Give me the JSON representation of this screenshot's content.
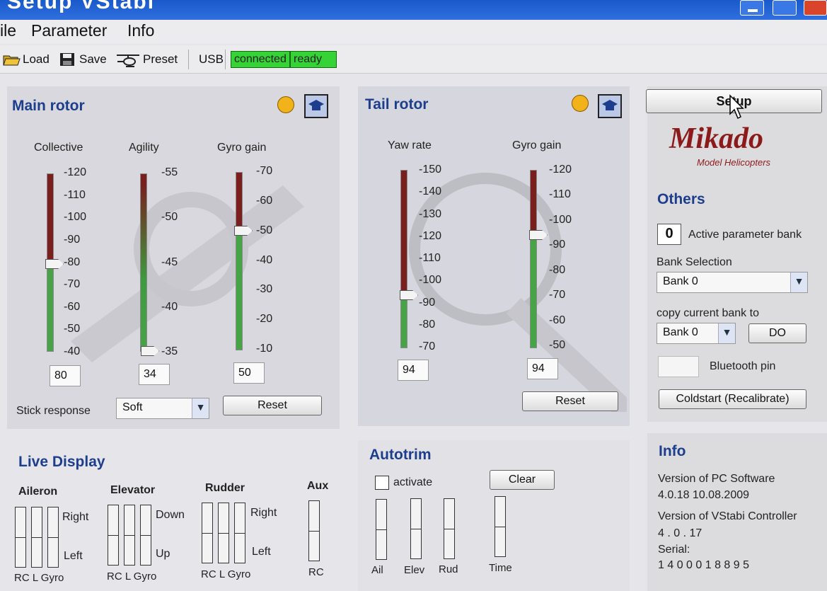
{
  "window": {
    "title": "Setup VStabi"
  },
  "menu": [
    "ile",
    "Parameter",
    "Info"
  ],
  "toolbar": {
    "load": "Load",
    "save": "Save",
    "preset": "Preset",
    "usb": "USB",
    "connected": "connected",
    "ready": "ready"
  },
  "main_rotor": {
    "title": "Main rotor",
    "collective": {
      "label": "Collective",
      "ticks": [
        "120",
        "110",
        "100",
        "90",
        "80",
        "70",
        "60",
        "50",
        "40"
      ],
      "value": "80"
    },
    "agility": {
      "label": "Agility",
      "ticks": [
        "55",
        "50",
        "45",
        "40",
        "35"
      ],
      "value": "34"
    },
    "gyro_gain": {
      "label": "Gyro gain",
      "ticks": [
        "70",
        "60",
        "50",
        "40",
        "30",
        "20",
        "10"
      ],
      "value": "50"
    },
    "stick_response_label": "Stick response",
    "stick_response_value": "Soft",
    "reset": "Reset"
  },
  "tail_rotor": {
    "title": "Tail rotor",
    "yaw_rate": {
      "label": "Yaw rate",
      "ticks": [
        "150",
        "140",
        "130",
        "120",
        "110",
        "100",
        "90",
        "80",
        "70"
      ],
      "value": "94"
    },
    "gyro_gain": {
      "label": "Gyro gain",
      "ticks": [
        "120",
        "110",
        "100",
        "90",
        "80",
        "70",
        "60",
        "50"
      ],
      "value": "94"
    },
    "reset": "Reset"
  },
  "side": {
    "setup": "Setup",
    "logo": "Mikado",
    "logo_sub": "Model Helicopters",
    "others_title": "Others",
    "active_bank_value": "0",
    "active_bank_label": "Active parameter bank",
    "bank_selection_label": "Bank Selection",
    "bank_selection_value": "Bank 0",
    "copy_label": "copy current bank to",
    "copy_value": "Bank 0",
    "do": "DO",
    "bluetooth_label": "Bluetooth pin",
    "coldstart": "Coldstart (Recalibrate)"
  },
  "live_display": {
    "title": "Live Display",
    "aileron": "Aileron",
    "elevator": "Elevator",
    "rudder": "Rudder",
    "aux": "Aux",
    "right": "Right",
    "left": "Left",
    "down": "Down",
    "up": "Up",
    "rc_l_gyro": "RC  L  Gyro",
    "rc": "RC"
  },
  "autotrim": {
    "title": "Autotrim",
    "activate": "activate",
    "clear": "Clear",
    "ail": "Ail",
    "elev": "Elev",
    "rud": "Rud",
    "time": "Time"
  },
  "info": {
    "title": "Info",
    "pc_label": "Version of PC Software",
    "pc_value": "4.0.18  10.08.2009",
    "ctrl_label": "Version of VStabi Controller",
    "ctrl_value": "4 . 0 . 17",
    "serial_label": "Serial:",
    "serial_value": "1 4 0 0 0 1 8 8 9 5"
  },
  "colors": {
    "accent": "#1d3e8c",
    "status_green": "#35d335",
    "titlebar": "#2f6fe0"
  }
}
